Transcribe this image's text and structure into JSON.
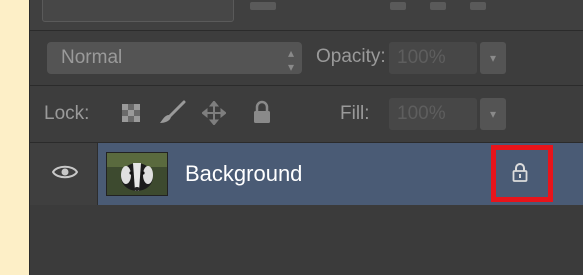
{
  "blend_mode": {
    "value": "Normal"
  },
  "opacity": {
    "label": "Opacity:",
    "value": "100%"
  },
  "lock": {
    "label": "Lock:"
  },
  "fill": {
    "label": "Fill:",
    "value": "100%"
  },
  "layers": [
    {
      "name": "Background",
      "visible": true,
      "locked": true
    }
  ],
  "icons": {
    "visibility": "eye-icon",
    "layer_lock": "lock-icon",
    "lock_transparent": "checkerboard-icon",
    "lock_image": "brush-icon",
    "lock_position": "move-icon",
    "lock_all": "lock-icon"
  },
  "colors": {
    "panel_bg": "#3b3b3b",
    "selected_layer": "#4a5b75",
    "highlight": "#e8141b",
    "page_bg": "#fdefc7"
  }
}
